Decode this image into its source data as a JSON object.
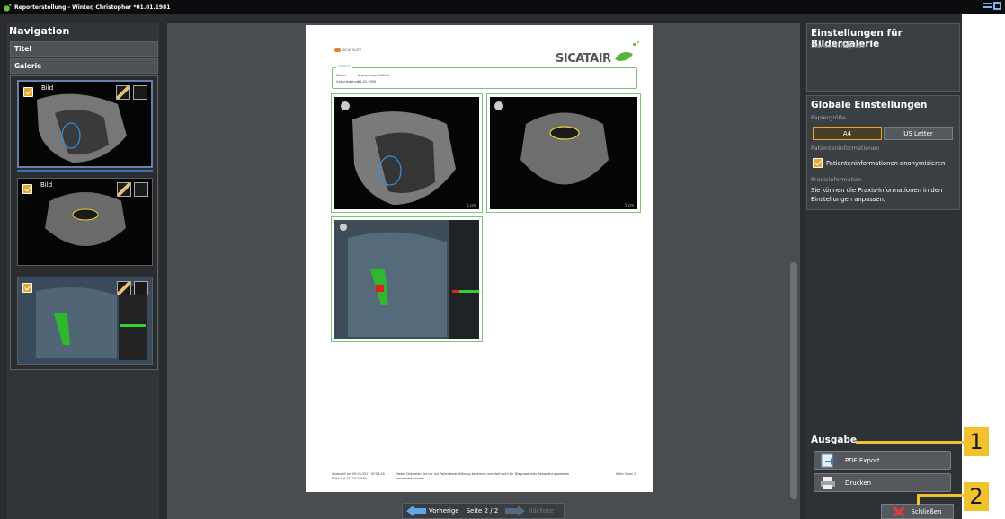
{
  "window": {
    "title": "Reporterstellung - Winter, Christopher *01.01.1981"
  },
  "navigation": {
    "heading": "Navigation",
    "items": [
      "Titel",
      "Galerie"
    ],
    "thumbs": [
      {
        "label": "Bild"
      },
      {
        "label": "Bild"
      },
      {
        "label": ""
      }
    ]
  },
  "report": {
    "brand": "SICATAIR",
    "small_brand": "SICAT SUITE",
    "patient_section": "PATIENT",
    "name_label": "Name:",
    "name_value": "Anonymous, Patient",
    "dob_label": "Geburtsdatum:",
    "dob_value": "01.01.1900",
    "footer_left": "Gedruckt am 09.05.2017 07:52:25\nBuild 1.4.17120.25839",
    "footer_mid": "Dieses Dokument ist nur zur Patientenaufklärung bestimmt und darf nicht für Diagnose oder Behandlungszwecke verwendet werden.",
    "footer_right": "Seite 2 von 2",
    "scale_1": "5 cm",
    "scale_2": "5 cm"
  },
  "pager": {
    "prev": "Vorherige",
    "page": "Seite 2 / 2",
    "next": "Nächste"
  },
  "gallery_settings": {
    "heading": "Einstellungen für Bildergalerie",
    "sub": "Standardbildgröße"
  },
  "global_settings": {
    "heading": "Globale Einstellungen",
    "paper_label": "Papiergröße",
    "paper_options": [
      "A4",
      "US Letter"
    ],
    "patient_info_label": "Patienteninformationen",
    "anonymize_label": "Patienteninformationen anonymisieren",
    "practice_label": "Praxisinformation",
    "practice_text": "Sie können die Praxis-Informationen in den Einstellungen anpassen."
  },
  "output": {
    "heading": "Ausgabe",
    "pdf_label": "PDF Export",
    "print_label": "Drucken",
    "close_label": "Schließen"
  },
  "callouts": [
    "1",
    "2"
  ],
  "colors": {
    "accent": "#e8a730",
    "callout": "#f2c12e",
    "frame_green": "#7ac57a"
  }
}
